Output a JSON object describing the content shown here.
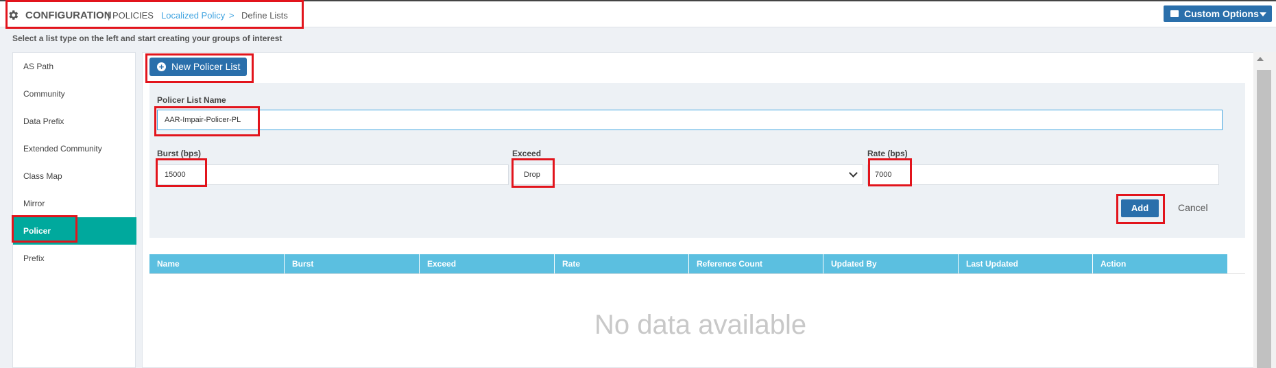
{
  "header": {
    "title": "CONFIGURATION",
    "section": "POLICIES",
    "breadcrumb_link": "Localized Policy",
    "breadcrumb_separator": ">",
    "breadcrumb_current": "Define Lists",
    "custom_options_label": "Custom Options"
  },
  "hint": "Select a list type on the left and start creating your groups of interest",
  "sidebar": {
    "items": [
      {
        "label": "AS Path",
        "active": false
      },
      {
        "label": "Community",
        "active": false
      },
      {
        "label": "Data Prefix",
        "active": false
      },
      {
        "label": "Extended Community",
        "active": false
      },
      {
        "label": "Class Map",
        "active": false
      },
      {
        "label": "Mirror",
        "active": false
      },
      {
        "label": "Policer",
        "active": true
      },
      {
        "label": "Prefix",
        "active": false
      }
    ]
  },
  "main": {
    "new_button_label": "New Policer List",
    "form": {
      "name_label": "Policer List Name",
      "name_value": "AAR-Impair-Policer-PL",
      "burst_label": "Burst (bps)",
      "burst_value": "15000",
      "exceed_label": "Exceed",
      "exceed_value": "Drop",
      "rate_label": "Rate (bps)",
      "rate_value": "7000",
      "add_label": "Add",
      "cancel_label": "Cancel"
    },
    "table": {
      "columns": [
        "Name",
        "Burst",
        "Exceed",
        "Rate",
        "Reference Count",
        "Updated By",
        "Last Updated",
        "Action"
      ],
      "empty_text": "No data available"
    }
  },
  "colors": {
    "accent_blue": "#2a6fab",
    "active_teal": "#00a99d",
    "table_header": "#5bbfe0",
    "highlight_red": "#e2141c"
  }
}
